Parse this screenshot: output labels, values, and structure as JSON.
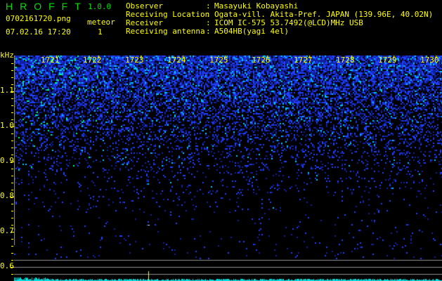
{
  "header": {
    "app_title": "HROFFT",
    "version": "1.0.0",
    "filename": "0702161720.png",
    "datetime": "07.02.16 17:20",
    "meteor_label": "meteor",
    "meteor_count": "1"
  },
  "info": [
    {
      "label": "Observer",
      "value": "Masayuki Kobayashi"
    },
    {
      "label": "Receiving Location",
      "value": "Ogata-vill. Akita-Pref. JAPAN (139.96E, 40.02N)"
    },
    {
      "label": "Receiver",
      "value": "ICOM IC-575 53.7492(@LCD)MHz USB"
    },
    {
      "label": "Receiving antenna",
      "value": "A504HB(yagi 4el)"
    }
  ],
  "spectrogram": {
    "y_unit": "kHz",
    "y_ticks": [
      "1.1",
      "1.0",
      "0.9",
      "0.8",
      "0.7",
      "0.6"
    ],
    "time_ticks": [
      "1721",
      "1722",
      "1723",
      "1724",
      "1725",
      "1726",
      "1727",
      "1728",
      "1729",
      "1730"
    ],
    "colors": {
      "noise": "#2040ff",
      "strong": "#00ffc0",
      "spectrum": "#00e0e0",
      "marker": "#ffff00",
      "grid": "#909090"
    }
  }
}
